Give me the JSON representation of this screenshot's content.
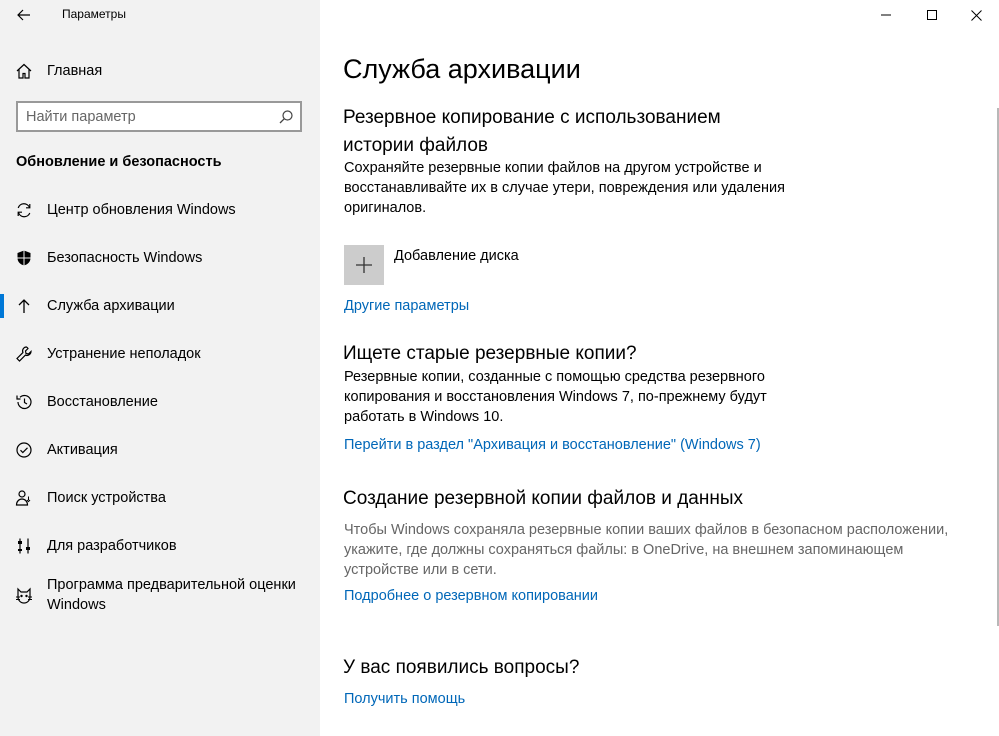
{
  "app": {
    "title": "Параметры"
  },
  "sidebar": {
    "home_label": "Главная",
    "search_placeholder": "Найти параметр",
    "section_title": "Обновление и безопасность",
    "items": [
      {
        "label": "Центр обновления Windows",
        "icon": "sync-icon"
      },
      {
        "label": "Безопасность Windows",
        "icon": "shield-icon"
      },
      {
        "label": "Служба архивации",
        "icon": "backup-arrow-icon",
        "selected": true
      },
      {
        "label": "Устранение неполадок",
        "icon": "wrench-icon"
      },
      {
        "label": "Восстановление",
        "icon": "history-icon"
      },
      {
        "label": "Активация",
        "icon": "check-circle-icon"
      },
      {
        "label": "Поиск устройства",
        "icon": "person-pin-icon"
      },
      {
        "label": "Для разработчиков",
        "icon": "developer-sliders-icon"
      },
      {
        "label_line1": "Программа предварительной оценки",
        "label_line2": "Windows",
        "icon": "insider-cat-icon"
      }
    ]
  },
  "accent_color": "#0078d7",
  "link_color": "#0067b8",
  "main": {
    "title": "Служба архивации",
    "file_history": {
      "heading_line1": "Резервное копирование с использованием",
      "heading_line2": "истории файлов",
      "desc_line1": "Сохраняйте резервные копии файлов на другом устройстве и",
      "desc_line2": "восстанавливайте их в случае утери, повреждения или удаления",
      "desc_line3": "оригиналов.",
      "add_drive_label": "Добавление диска",
      "more_options_link": "Другие параметры"
    },
    "old_backups": {
      "heading": "Ищете старые резервные копии?",
      "desc_line1": "Резервные копии, созданные с помощью средства резервного",
      "desc_line2": "копирования и восстановления Windows 7, по-прежнему будут",
      "desc_line3": "работать в Windows 10.",
      "link": "Перейти в раздел \"Архивация и восстановление\" (Windows 7)"
    },
    "create_backup": {
      "heading": "Создание резервной копии файлов и данных",
      "desc_line1": "Чтобы Windows сохраняла резервные копии ваших файлов в безопасном расположении,",
      "desc_line2": "укажите, где должны сохраняться файлы: в OneDrive, на внешнем запоминающем",
      "desc_line3": "устройстве или в сети.",
      "link": "Подробнее о резервном копировании"
    },
    "questions": {
      "heading": "У вас появились вопросы?",
      "link": "Получить помощь"
    }
  }
}
